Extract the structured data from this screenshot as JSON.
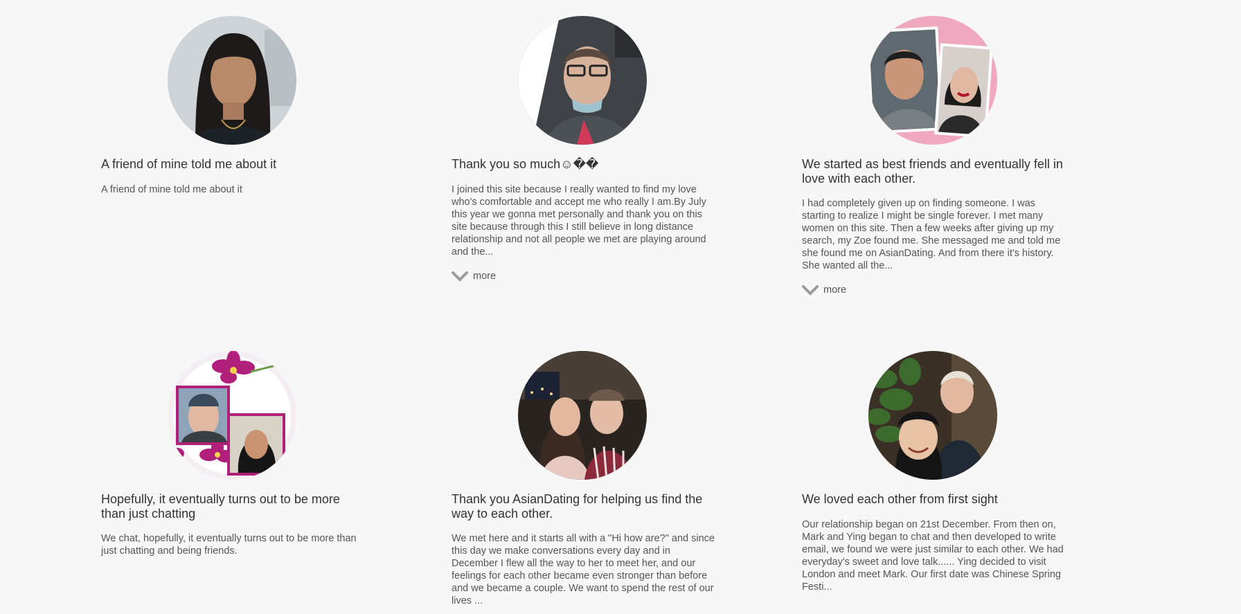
{
  "stories": [
    {
      "title": "A friend of mine told me about it",
      "text": "A friend of mine told me about it",
      "more_label": ""
    },
    {
      "title": "Thank you so much☺��",
      "text": "I joined this site because I really wanted to find my love who's comfortable and accept me who really I am.By July this year we gonna met personally and thank you on this site because through this I still believe in long distance relationship and not all people we met are playing around and the...",
      "more_label": "more"
    },
    {
      "title": "We started as best friends and eventually fell in love with each other.",
      "text": "I had completely given up on finding someone. I was starting to realize I might be single forever. I met many women on this site. Then a few weeks after giving up my search, my Zoe found me. She messaged me and told me she found me on AsianDating. And from there it's history. She wanted all the...",
      "more_label": "more"
    },
    {
      "title": "Hopefully, it eventually turns out to be more than just chatting",
      "text": "We chat, hopefully, it eventually turns out to be more than just chatting and being friends.",
      "more_label": ""
    },
    {
      "title": "Thank you AsianDating for helping us find the way to each other.",
      "text": "We met here and it starts all with a \"Hi how are?\" and since this day we make conversations every day and in December I flew all the way to her to meet her, and our feelings for each other became even stronger than before and we became a couple. We want to spend the rest of our lives ...",
      "more_label": ""
    },
    {
      "title": "We loved each other from first sight",
      "text": "Our relationship began on 21st December. From then on, Mark and Ying began to chat and then developed to write email, we found we were just similar to each other. We had everyday's sweet and love talk...... Ying decided to visit London and meet Mark. Our first date was Chinese Spring Festi...",
      "more_label": ""
    }
  ],
  "colors": {
    "background": "#f7f7f7",
    "title": "#333333",
    "body": "#555555",
    "chevron": "#9a9a9a",
    "accent_pink": "#f0a8c0",
    "orchid": "#b0207a"
  },
  "icons": {
    "more": "chevron-down-icon"
  }
}
